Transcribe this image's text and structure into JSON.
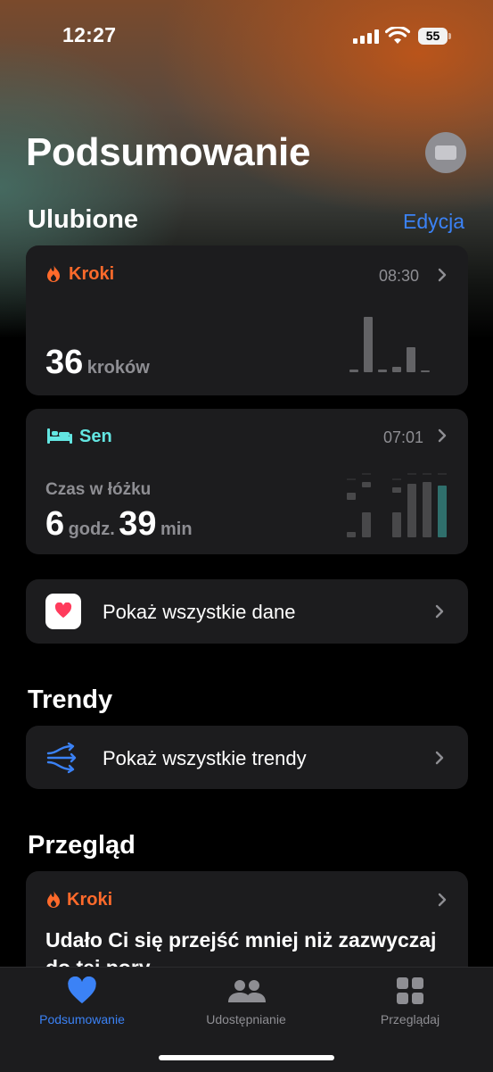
{
  "status_bar": {
    "time": "12:27",
    "battery": "55"
  },
  "header": {
    "title": "Podsumowanie"
  },
  "favorites": {
    "title": "Ulubione",
    "edit_label": "Edycja",
    "steps_card": {
      "label": "Kroki",
      "time": "08:30",
      "value": "36",
      "unit": "kroków",
      "accent": "#ff6a2b",
      "bar_levels": [
        0.05,
        1.0,
        0.05,
        0.1,
        0.45,
        0.02
      ]
    },
    "sleep_card": {
      "label": "Sen",
      "time": "07:01",
      "subtitle": "Czas w łóżku",
      "hours": "6",
      "hours_unit": "godz.",
      "minutes": "39",
      "minutes_unit": "min",
      "accent": "#63e6e2"
    },
    "show_all_data": "Pokaż wszystkie dane"
  },
  "trends": {
    "title": "Trendy",
    "show_all": "Pokaż wszystkie trendy"
  },
  "highlights": {
    "title": "Przegląd",
    "card_label": "Kroki",
    "card_text": "Udało Ci się przejść mniej niż zazwyczaj",
    "card_text_2": "do tej pory"
  },
  "tab_bar": {
    "tabs": [
      {
        "label": "Podsumowanie",
        "active": true
      },
      {
        "label": "Udostępnianie",
        "active": false
      },
      {
        "label": "Przeglądaj",
        "active": false
      }
    ],
    "active_color": "#3b82f6",
    "inactive_color": "#8e8e93"
  }
}
